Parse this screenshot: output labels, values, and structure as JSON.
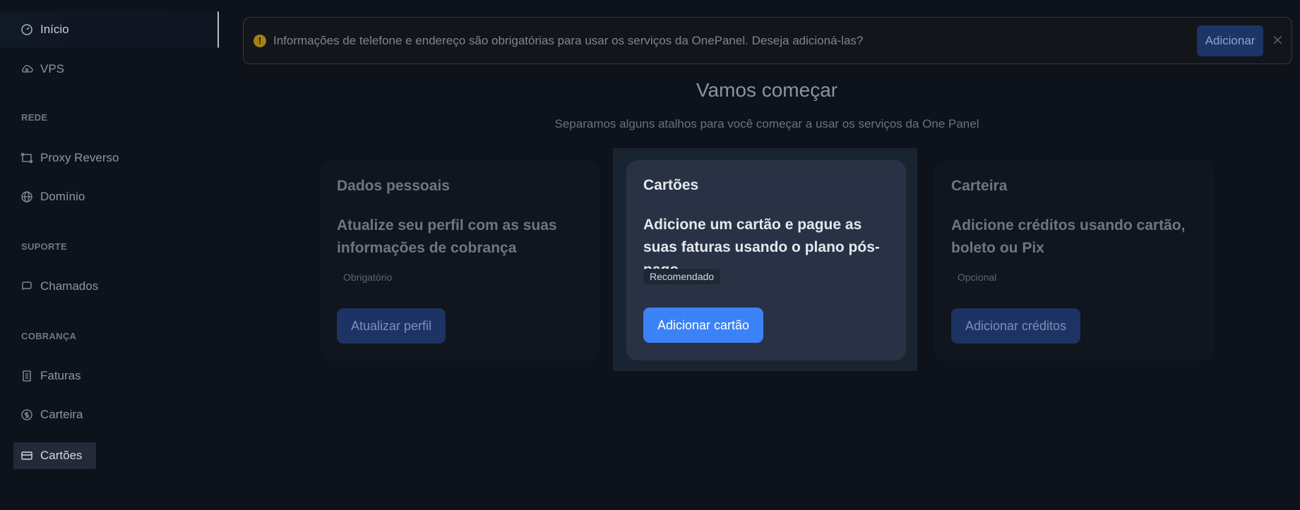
{
  "sidebar": {
    "items": [
      {
        "label": "Início",
        "icon": "gauge-icon"
      },
      {
        "label": "VPS",
        "icon": "cloud-icon"
      },
      {
        "label": "Proxy Reverso",
        "icon": "proxy-icon"
      },
      {
        "label": "Domínio",
        "icon": "globe-icon"
      },
      {
        "label": "Chamados",
        "icon": "chat-icon"
      },
      {
        "label": "Faturas",
        "icon": "invoice-icon"
      },
      {
        "label": "Carteira",
        "icon": "coin-icon"
      },
      {
        "label": "Cartões",
        "icon": "card-icon"
      }
    ],
    "sections": {
      "rede": "REDE",
      "suporte": "SUPORTE",
      "cobranca": "COBRANÇA"
    }
  },
  "alert": {
    "message": "Informações de telefone e endereço são obrigatórias para usar os serviços da OnePanel. Deseja adicioná-las?",
    "button": "Adicionar",
    "close": "✕"
  },
  "header": {
    "title": "Vamos começar",
    "subtitle": "Separamos alguns atalhos para você começar a usar os serviços da One Panel"
  },
  "cards": [
    {
      "title": "Dados pessoais",
      "description": "Atualize seu perfil com as suas informações de cobrança",
      "badge": "Obrigatório",
      "button": "Atualizar perfil"
    },
    {
      "title": "Cartões",
      "description": "Adicione um cartão e pague as suas faturas usando o plano pós-pago",
      "badge": "Recomendado",
      "button": "Adicionar cartão"
    },
    {
      "title": "Carteira",
      "description": "Adicione créditos usando cartão, boleto ou Pix",
      "badge": "Opcional",
      "button": "Adicionar créditos"
    }
  ],
  "colors": {
    "background": "#0d121b",
    "accent": "#3b82f6",
    "warning": "#a57f12"
  }
}
